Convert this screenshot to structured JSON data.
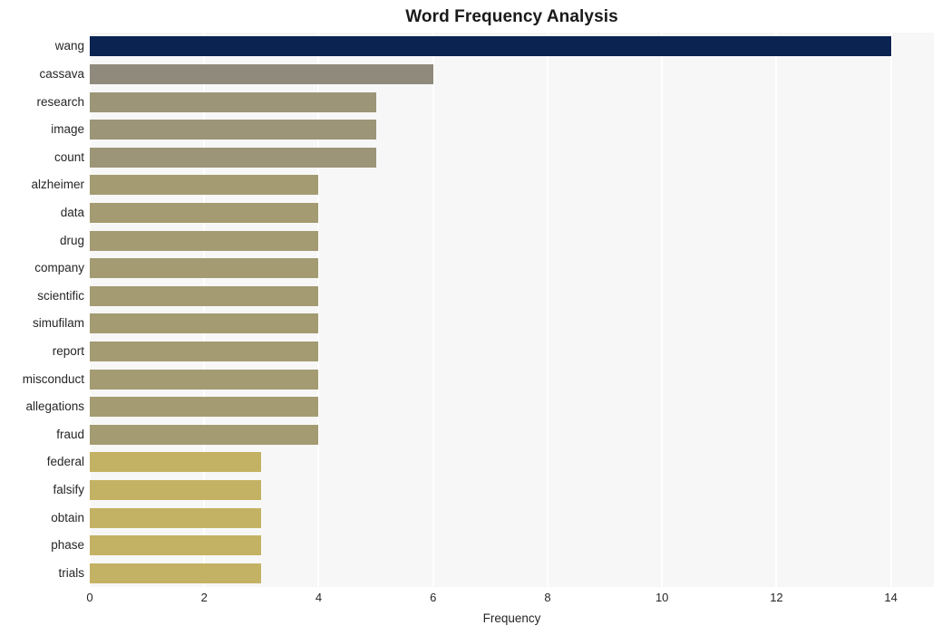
{
  "chart_data": {
    "type": "bar",
    "orientation": "horizontal",
    "title": "Word Frequency Analysis",
    "xlabel": "Frequency",
    "ylabel": "",
    "xlim": [
      0,
      14.75
    ],
    "xticks": [
      0,
      2,
      4,
      6,
      8,
      10,
      12,
      14
    ],
    "xtick_labels": [
      "0",
      "2",
      "4",
      "6",
      "8",
      "10",
      "12",
      "14"
    ],
    "grid": true,
    "grid_axis": "x",
    "legend": "none",
    "categories": [
      "wang",
      "cassava",
      "research",
      "image",
      "count",
      "alzheimer",
      "data",
      "drug",
      "company",
      "scientific",
      "simufilam",
      "report",
      "misconduct",
      "allegations",
      "fraud",
      "federal",
      "falsify",
      "obtain",
      "phase",
      "trials"
    ],
    "values": [
      14,
      6,
      5,
      5,
      5,
      4,
      4,
      4,
      4,
      4,
      4,
      4,
      4,
      4,
      4,
      3,
      3,
      3,
      3,
      3
    ],
    "bar_colors": [
      "#0a2351",
      "#8f8a7c",
      "#9c9577",
      "#9c9577",
      "#9c9577",
      "#a49b72",
      "#a49b72",
      "#a49b72",
      "#a49b72",
      "#a49b72",
      "#a49b72",
      "#a49b72",
      "#a49b72",
      "#a49b72",
      "#a49b72",
      "#c4b264",
      "#c4b264",
      "#c4b264",
      "#c4b264",
      "#c4b264"
    ],
    "plot_background": "#f7f7f7",
    "grid_color": "#ffffff",
    "figure_background": "#ffffff",
    "text_color": "#262626"
  }
}
